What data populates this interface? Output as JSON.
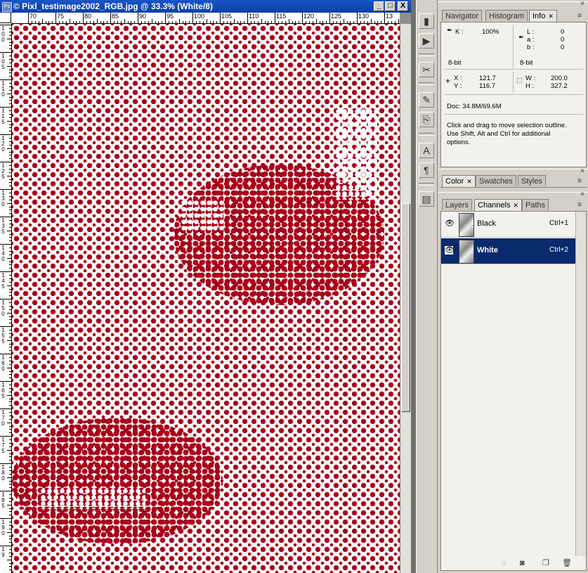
{
  "document": {
    "title": "© Pixl_testimage2002_RGB.jpg @ 33.3% (White/8)",
    "ps_icon": "Ps",
    "window_buttons": {
      "minimize": "_",
      "maximize": "□",
      "close": "X"
    },
    "h_ruler_labels": [
      "70",
      "75",
      "80",
      "85",
      "90",
      "95",
      "100",
      "105",
      "110",
      "115",
      "120",
      "125",
      "130",
      "13"
    ],
    "v_ruler_labels": [
      "100",
      "105",
      "110",
      "115",
      "120",
      "125",
      "130",
      "135",
      "140",
      "145",
      "150",
      "155",
      "160",
      "165",
      "170",
      "175",
      "180",
      "185",
      "190",
      "19"
    ],
    "halftone_color": "#a8001a"
  },
  "toolbox": {
    "buttons": [
      "navigator-toggle-icon",
      "actions-icon",
      "tool-presets-icon",
      "brushes-icon",
      "clone-source-icon",
      "character-icon",
      "paragraph-icon",
      "notes-icon"
    ]
  },
  "info_panel": {
    "tabs": [
      "Navigator",
      "Histogram",
      "Info"
    ],
    "k_label": "K :",
    "k_value": "100%",
    "l_label": "L :",
    "l_value": "0",
    "a_label": "a :",
    "a_value": "0",
    "b_label": "b :",
    "b_value": "0",
    "bit_left": "8-bit",
    "bit_right": "8-bit",
    "x_label": "X :",
    "x_value": "121.7",
    "y_label": "Y :",
    "y_value": "116.7",
    "w_label": "W :",
    "w_value": "200.0",
    "h_label": "H :",
    "h_value": "327.2",
    "doc": "Doc: 34.8M/69.6M",
    "hint_line1": "Click and drag to move selection outline.",
    "hint_line2": " Use Shift, Alt and Ctrl for additional",
    "hint_line3": "options."
  },
  "color_panel": {
    "tabs": [
      "Color",
      "Swatches",
      "Styles"
    ]
  },
  "layers_panel": {
    "tabs": [
      "Layers",
      "Channels",
      "Paths"
    ],
    "channels": [
      {
        "name": "Black",
        "shortcut": "Ctrl+1",
        "selected": false
      },
      {
        "name": "White",
        "shortcut": "Ctrl+2",
        "selected": true
      }
    ]
  }
}
